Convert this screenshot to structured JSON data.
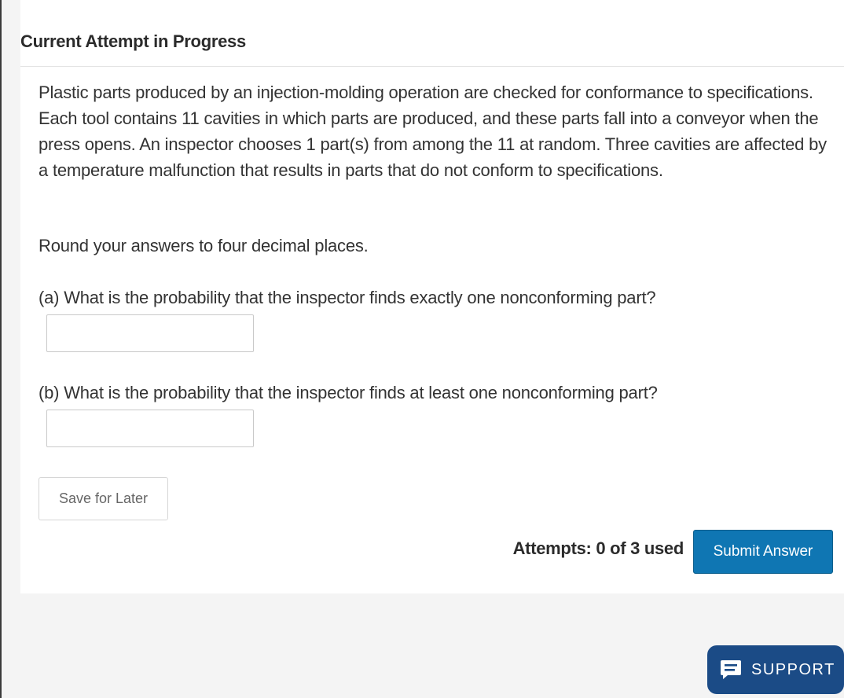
{
  "page": {
    "heading": "Current Attempt in Progress"
  },
  "question": {
    "text": "Plastic parts produced by an injection-molding operation are checked for conformance to specifications. Each tool contains 11 cavities in which parts are produced, and these parts fall into a conveyor when the press opens. An inspector chooses 1 part(s) from among the 11 at random. Three cavities are affected by a temperature malfunction that results in parts that do not conform to specifications.",
    "round_note": "Round your answers to four decimal places."
  },
  "parts": [
    {
      "label": "(a) What is the probability that the inspector finds exactly one nonconforming part?",
      "value": ""
    },
    {
      "label": "(b) What is the probability that the inspector finds at least one nonconforming part?",
      "value": ""
    }
  ],
  "actions": {
    "save_label": "Save for Later",
    "attempts_text": "Attempts: 0 of 3 used",
    "submit_label": "Submit Answer"
  },
  "support": {
    "label": "SUPPORT",
    "icon": "chat-icon"
  },
  "colors": {
    "submit_bg": "#0f76b3",
    "support_bg": "#1b4b86",
    "page_bg": "#f4f4f4",
    "card_bg": "#ffffff"
  }
}
